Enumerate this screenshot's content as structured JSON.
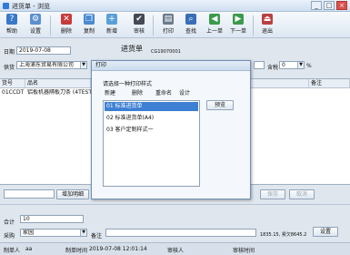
{
  "window": {
    "title": "进货单 - 浏览"
  },
  "toolbar": [
    {
      "label": "帮助",
      "icon": "help-icon",
      "color": "#3a78c8"
    },
    {
      "label": "设置",
      "icon": "gear-icon",
      "color": "#5a8fd0"
    },
    {
      "label": "删除",
      "icon": "delete-icon",
      "color": "#c83a3a"
    },
    {
      "label": "复制",
      "icon": "copy-icon",
      "color": "#4a8ad0"
    },
    {
      "label": "新增",
      "icon": "new-icon",
      "color": "#5aa0d8"
    },
    {
      "label": "审核",
      "icon": "audit-icon",
      "color": "#444a55"
    },
    {
      "label": "打印",
      "icon": "print-icon",
      "color": "#6a7a8c"
    },
    {
      "label": "查找",
      "icon": "find-icon",
      "color": "#3a6fb8"
    },
    {
      "label": "上一单",
      "icon": "prev-icon",
      "color": "#3a9a4a"
    },
    {
      "label": "下一单",
      "icon": "next-icon",
      "color": "#3a9a4a"
    },
    {
      "label": "退出",
      "icon": "exit-icon",
      "color": "#b84040"
    }
  ],
  "header": {
    "date_label": "日期",
    "date_value": "2019-07-08",
    "form_title": "进货单",
    "doc_no": "CG19070001",
    "supplier_label": "供货",
    "supplier_value": "上海浦东贸易有限公司",
    "tax_label": "含税",
    "tax_value": "0",
    "tax_unit": "%"
  },
  "grid": {
    "columns": [
      "货号",
      "品名",
      "备注"
    ],
    "rows": [
      {
        "code": "01CCDT",
        "name": "铝板机器隔板刀条 (4TEST"
      }
    ]
  },
  "dialog": {
    "title": "打印",
    "prompt": "请选择一种打印样式",
    "tabs": [
      "新建",
      "删除",
      "重命名",
      "设计"
    ],
    "items": [
      "01 标准进货单",
      "02 标准进货单(A4)",
      "03 客户定制样式一"
    ],
    "preview_label": "预览"
  },
  "bottom": {
    "add_detail": "增加明细",
    "save_label": "保存",
    "cancel_label": "取消",
    "total_label": "合计",
    "total_value": "10",
    "settle_label": "采购",
    "settle_value": "家园",
    "remark_label": "备注",
    "summary_value": "1835.15, 累欠8645.2",
    "settle_btn": "设置",
    "footer": [
      {
        "label": "制单人",
        "value": "aa"
      },
      {
        "label": "制单时间",
        "value": "2019-07-08 12:01:14"
      },
      {
        "label": "审核人",
        "value": ""
      },
      {
        "label": "审核时间",
        "value": ""
      }
    ]
  }
}
